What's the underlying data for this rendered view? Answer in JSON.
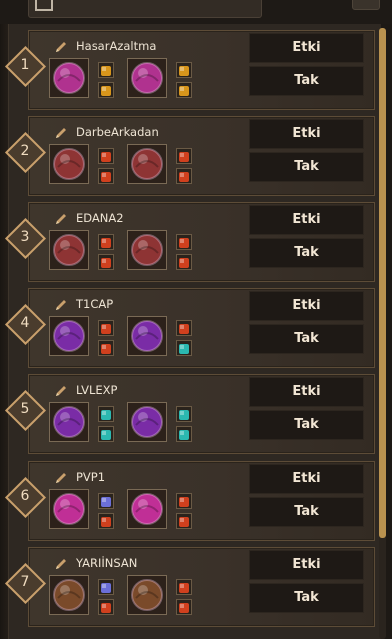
{
  "sets": [
    {
      "number": "1",
      "name": "HasarAzaltma",
      "etki": "Etki",
      "tak": "Tak",
      "main_color": "#b0328f",
      "stones": [
        "#d8961c",
        "#d8961c",
        "#d8961c",
        "#d8961c"
      ]
    },
    {
      "number": "2",
      "name": "DarbeArkadan",
      "etki": "Etki",
      "tak": "Tak",
      "main_color": "#8e3434",
      "stones": [
        "#d0401e",
        "#d0401e",
        "#d0401e",
        "#d0401e"
      ]
    },
    {
      "number": "3",
      "name": "EDANA2",
      "etki": "Etki",
      "tak": "Tak",
      "main_color": "#8e3434",
      "stones": [
        "#d0401e",
        "#d0401e",
        "#d0401e",
        "#d0401e"
      ]
    },
    {
      "number": "4",
      "name": "T1CAP",
      "etki": "Etki",
      "tak": "Tak",
      "main_color": "#7a2ca6",
      "stones": [
        "#d0401e",
        "#d0401e",
        "#d0401e",
        "#2bb8b0"
      ]
    },
    {
      "number": "5",
      "name": "LVLEXP",
      "etki": "Etki",
      "tak": "Tak",
      "main_color": "#7a2ca6",
      "stones": [
        "#2bb8b0",
        "#2bb8b0",
        "#2bb8b0",
        "#2bb8b0"
      ]
    },
    {
      "number": "6",
      "name": "PVP1",
      "etki": "Etki",
      "tak": "Tak",
      "main_color": "#c02f96",
      "stones": [
        "#6b6fd8",
        "#d0401e",
        "#d0401e",
        "#d0401e"
      ]
    },
    {
      "number": "7",
      "name": "YARIİNSAN",
      "etki": "Etki",
      "tak": "Tak",
      "main_color": "#7a4a2a",
      "stones": [
        "#6b6fd8",
        "#d0401e",
        "#d0401e",
        "#d0401e"
      ]
    }
  ],
  "colors": {
    "accent": "#c9a06c",
    "scroll": "#b9924f"
  }
}
